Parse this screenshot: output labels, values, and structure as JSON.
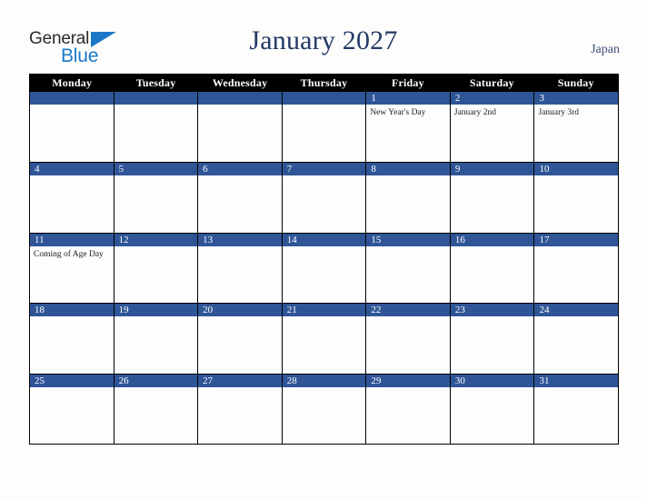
{
  "brand": {
    "name_part1": "General",
    "name_part2": "Blue",
    "accent_color": "#1b78c8"
  },
  "header": {
    "title": "January 2027",
    "country": "Japan",
    "title_color": "#243a66"
  },
  "calendar": {
    "weekday_headers": [
      "Monday",
      "Tuesday",
      "Wednesday",
      "Thursday",
      "Friday",
      "Saturday",
      "Sunday"
    ],
    "header_bg": "#000000",
    "daybar_bg": "#2f5597",
    "cell_bg": "#fdfdfe",
    "weeks": [
      [
        {
          "num": "",
          "events": []
        },
        {
          "num": "",
          "events": []
        },
        {
          "num": "",
          "events": []
        },
        {
          "num": "",
          "events": []
        },
        {
          "num": "1",
          "events": [
            "New Year's Day"
          ]
        },
        {
          "num": "2",
          "events": [
            "January 2nd"
          ]
        },
        {
          "num": "3",
          "events": [
            "January 3rd"
          ]
        }
      ],
      [
        {
          "num": "4",
          "events": []
        },
        {
          "num": "5",
          "events": []
        },
        {
          "num": "6",
          "events": []
        },
        {
          "num": "7",
          "events": []
        },
        {
          "num": "8",
          "events": []
        },
        {
          "num": "9",
          "events": []
        },
        {
          "num": "10",
          "events": []
        }
      ],
      [
        {
          "num": "11",
          "events": [
            "Coming of Age Day"
          ]
        },
        {
          "num": "12",
          "events": []
        },
        {
          "num": "13",
          "events": []
        },
        {
          "num": "14",
          "events": []
        },
        {
          "num": "15",
          "events": []
        },
        {
          "num": "16",
          "events": []
        },
        {
          "num": "17",
          "events": []
        }
      ],
      [
        {
          "num": "18",
          "events": []
        },
        {
          "num": "19",
          "events": []
        },
        {
          "num": "20",
          "events": []
        },
        {
          "num": "21",
          "events": []
        },
        {
          "num": "22",
          "events": []
        },
        {
          "num": "23",
          "events": []
        },
        {
          "num": "24",
          "events": []
        }
      ],
      [
        {
          "num": "25",
          "events": []
        },
        {
          "num": "26",
          "events": []
        },
        {
          "num": "27",
          "events": []
        },
        {
          "num": "28",
          "events": []
        },
        {
          "num": "29",
          "events": []
        },
        {
          "num": "30",
          "events": []
        },
        {
          "num": "31",
          "events": []
        }
      ]
    ]
  }
}
